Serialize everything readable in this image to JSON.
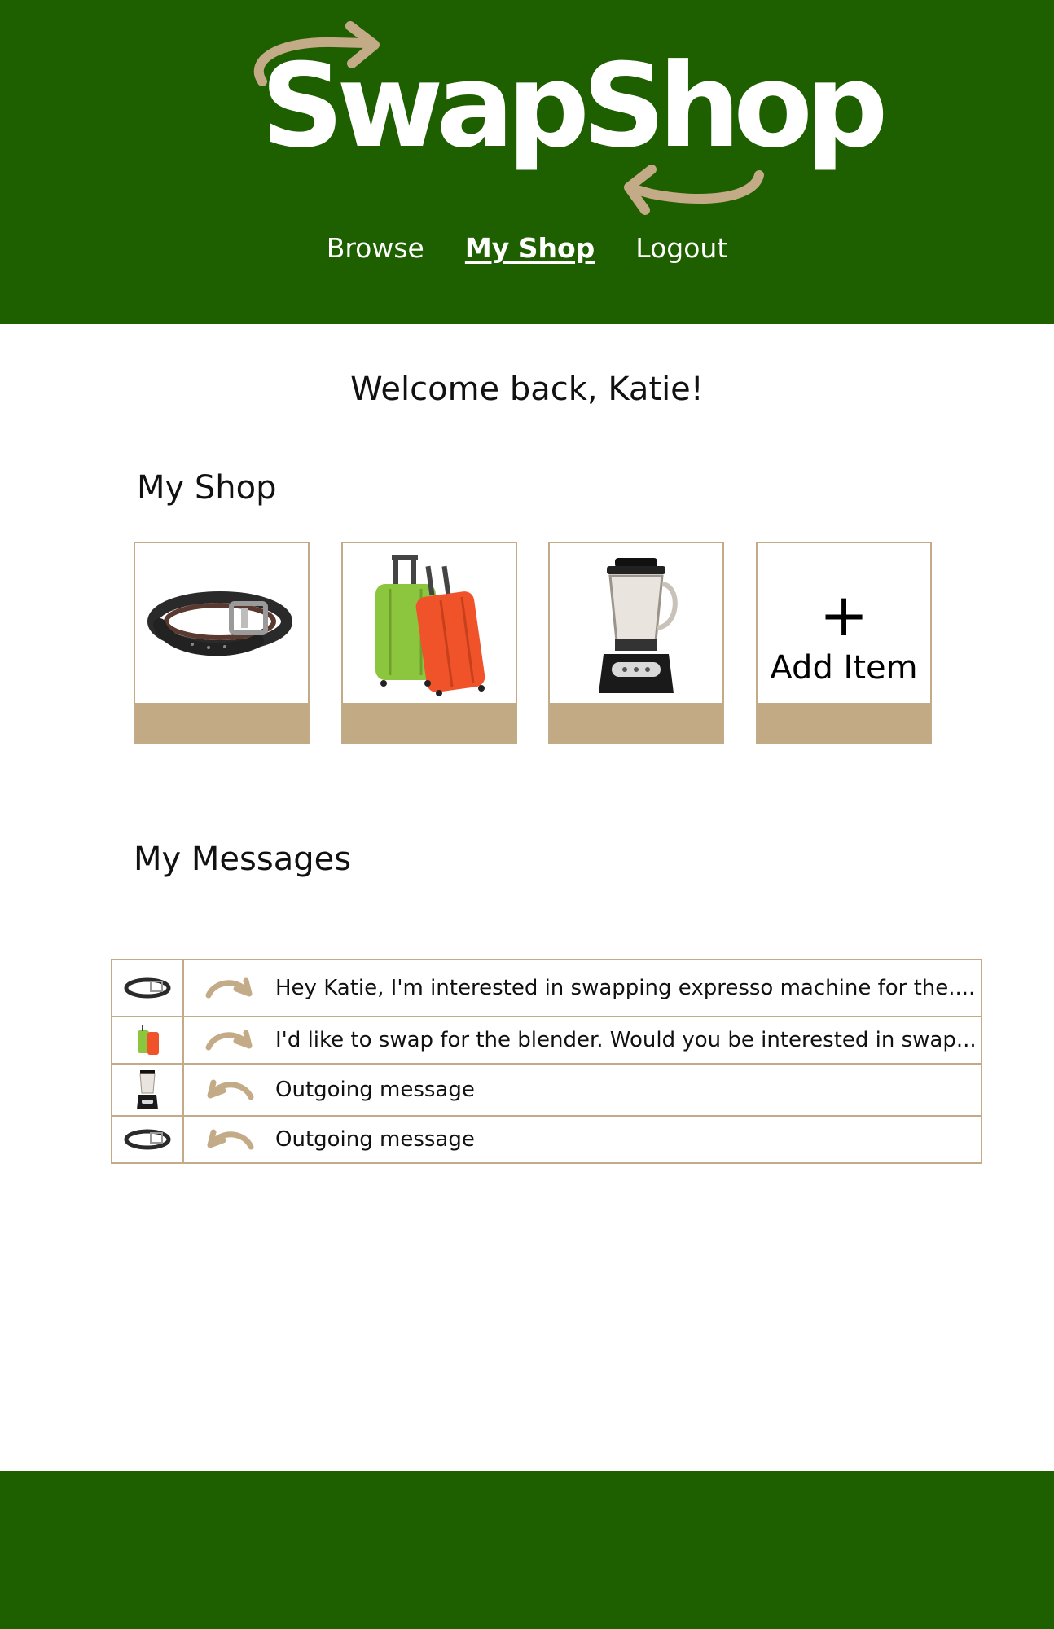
{
  "app": {
    "logo_text": "SwapShop"
  },
  "nav": {
    "items": [
      {
        "label": "Browse",
        "active": false
      },
      {
        "label": "My Shop",
        "active": true
      },
      {
        "label": "Logout",
        "active": false
      }
    ]
  },
  "welcome": "Welcome back, Katie!",
  "my_shop": {
    "title": "My Shop",
    "items": [
      {
        "icon": "belt-image"
      },
      {
        "icon": "luggage-image"
      },
      {
        "icon": "blender-image"
      }
    ],
    "add_item": {
      "symbol": "+",
      "label": "Add Item"
    }
  },
  "my_messages": {
    "title": "My Messages",
    "rows": [
      {
        "item_icon": "belt-image",
        "direction": "incoming",
        "text": "Hey Katie, I'm interested in swapping expresso machine for the...."
      },
      {
        "item_icon": "luggage-image",
        "direction": "incoming",
        "text": "I'd like to swap for the blender. Would you be interested in swap..."
      },
      {
        "item_icon": "blender-image",
        "direction": "outgoing",
        "text": "Outgoing message"
      },
      {
        "item_icon": "belt-image",
        "direction": "outgoing",
        "text": "Outgoing message"
      }
    ]
  },
  "colors": {
    "brand_green": "#1e6000",
    "accent_tan": "#c2aa85",
    "arrow_tan": "#c4ab88"
  }
}
